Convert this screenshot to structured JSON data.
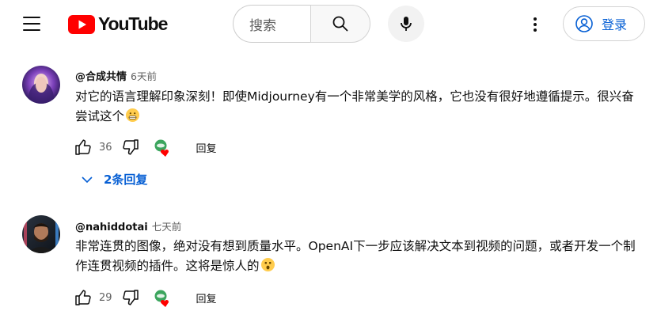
{
  "header": {
    "logo_text": "YouTube",
    "search_placeholder": "搜索",
    "signin_label": "登录",
    "colors": {
      "brand_red": "#ff0000",
      "link_blue": "#065fd4"
    }
  },
  "comments": [
    {
      "author": "@合成共情",
      "time": "6天前",
      "text": "对它的语言理解印象深刻！即使Midjourney有一个非常美学的风格，它也没有很好地遵循提示。很兴奋尝试这个",
      "emoji": "grimacing-face",
      "likes": "36",
      "reply_label": "回复",
      "replies_label": "2条回复"
    },
    {
      "author": "@nahiddotai",
      "time": "七天前",
      "text": "非常连贯的图像，绝对没有想到质量水平。OpenAI下一步应该解决文本到视频的问题，或者开发一个制作连贯视频的插件。这将是惊人的",
      "emoji": "astonished-face",
      "likes": "29",
      "reply_label": "回复"
    }
  ]
}
